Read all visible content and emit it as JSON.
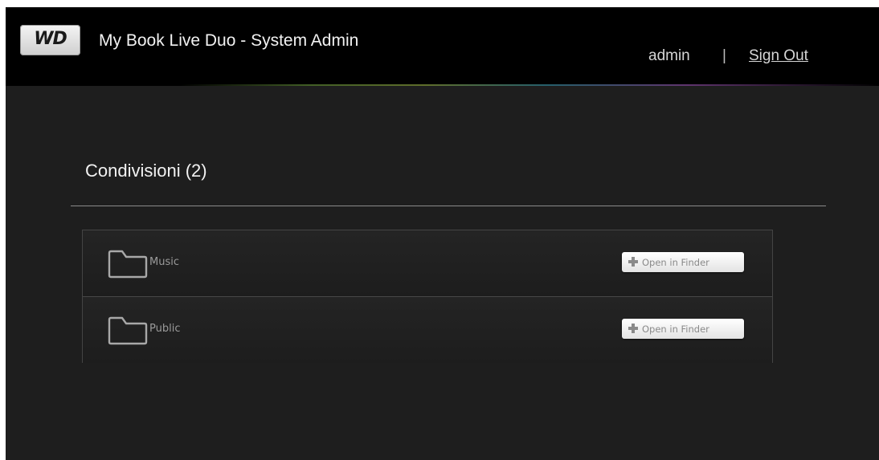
{
  "header": {
    "logo_text": "WD",
    "app_title": "My Book Live Duo - System Admin",
    "user": "admin",
    "separator": "|",
    "sign_out_label": "Sign Out"
  },
  "shares": {
    "title": "Condivisioni (2)",
    "items": [
      {
        "name": "Music",
        "action_label": "Open in Finder",
        "icon": "folder-icon"
      },
      {
        "name": "Public",
        "action_label": "Open in Finder",
        "icon": "folder-icon"
      }
    ]
  },
  "colors": {
    "header_bg": "#000000",
    "content_bg": "#1e1e1e",
    "text_primary": "#f2f2f2"
  }
}
